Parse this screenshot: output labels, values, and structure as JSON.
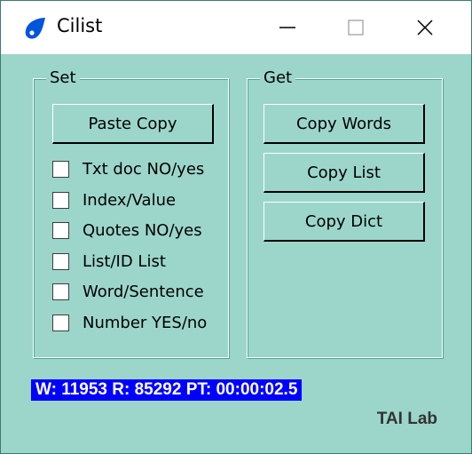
{
  "window": {
    "title": "Cilist",
    "icon": "droplet-icon"
  },
  "titlebar": {
    "minimize_icon": "minimize-icon",
    "maximize_icon": "maximize-icon",
    "close_icon": "close-icon"
  },
  "set_group": {
    "legend": "Set",
    "paste_label": "Paste Copy",
    "checkboxes": [
      {
        "label": "Txt doc NO/yes",
        "checked": false
      },
      {
        "label": "Index/Value",
        "checked": false
      },
      {
        "label": "Quotes NO/yes",
        "checked": false
      },
      {
        "label": "List/ID List",
        "checked": false
      },
      {
        "label": "Word/Sentence",
        "checked": false
      },
      {
        "label": "Number YES/no",
        "checked": false
      }
    ]
  },
  "get_group": {
    "legend": "Get",
    "buttons": [
      {
        "label": "Copy Words"
      },
      {
        "label": "Copy List"
      },
      {
        "label": "Copy Dict"
      }
    ]
  },
  "status": {
    "text": "W: 11953 R: 85292 PT: 00:00:02.5"
  },
  "brand": {
    "text": "TAI Lab"
  },
  "colors": {
    "background": "#9cd6cb",
    "status_bg": "#0000ff",
    "icon_blue": "#0055dd"
  }
}
